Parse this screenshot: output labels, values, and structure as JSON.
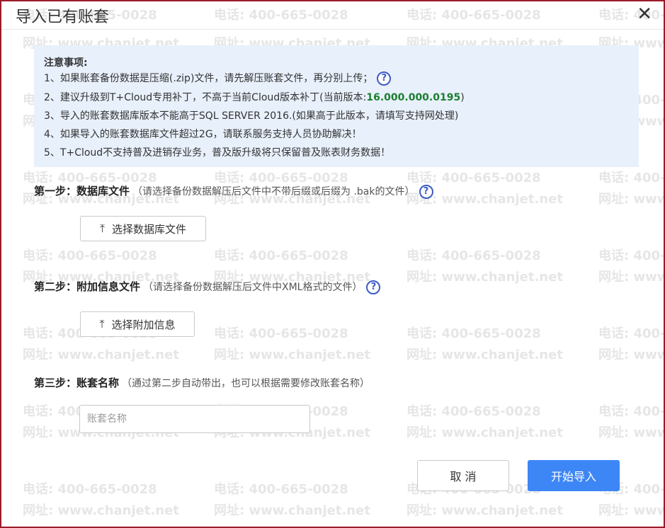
{
  "dialog": {
    "title": "导入已有账套",
    "close_glyph": "✕"
  },
  "watermark": {
    "phone": "电话: 400-665-0028",
    "site": "网址: www.chanjet.net"
  },
  "notice": {
    "title": "注意事项:",
    "lines": [
      "1、如果账套备份数据是压缩(.zip)文件，请先解压账套文件，再分别上传；",
      "2、建议升级到T+Cloud专用补丁，不高于当前Cloud版本补丁(当前版本:",
      "3、导入的账套数据库版本不能高于SQL SERVER 2016.(如果高于此版本，请填写支持网处理)",
      "4、如果导入的账套数据库文件超过2G，请联系服务支持人员协助解决！",
      "5、T+Cloud不支持普及进销存业务，普及版升级将只保留普及账表财务数据！"
    ],
    "version": "16.000.000.0195",
    "version_suffix": ")"
  },
  "steps": {
    "step1": {
      "label": "第一步：数据库文件",
      "hint": "（请选择备份数据解压后文件中不带后缀或后缀为 .bak的文件）",
      "button": "选择数据库文件"
    },
    "step2": {
      "label": "第二步：附加信息文件",
      "hint": "（请选择备份数据解压后文件中XML格式的文件）",
      "button": "选择附加信息"
    },
    "step3": {
      "label": "第三步：账套名称",
      "hint": "（通过第二步自动带出，也可以根据需要修改账套名称）",
      "input_placeholder": "账套名称",
      "input_value": ""
    }
  },
  "footer": {
    "cancel_label": "取 消",
    "start_label": "开始导入"
  },
  "colors": {
    "primary": "#3d86f5",
    "notice_bg": "#e8f0fb",
    "frame_border": "#9b1b2a",
    "version_green": "#1a7f2f",
    "help_icon": "#3d5bc4"
  },
  "icons": {
    "help": "question-circle-icon",
    "upload": "upload-icon",
    "close": "close-icon"
  }
}
